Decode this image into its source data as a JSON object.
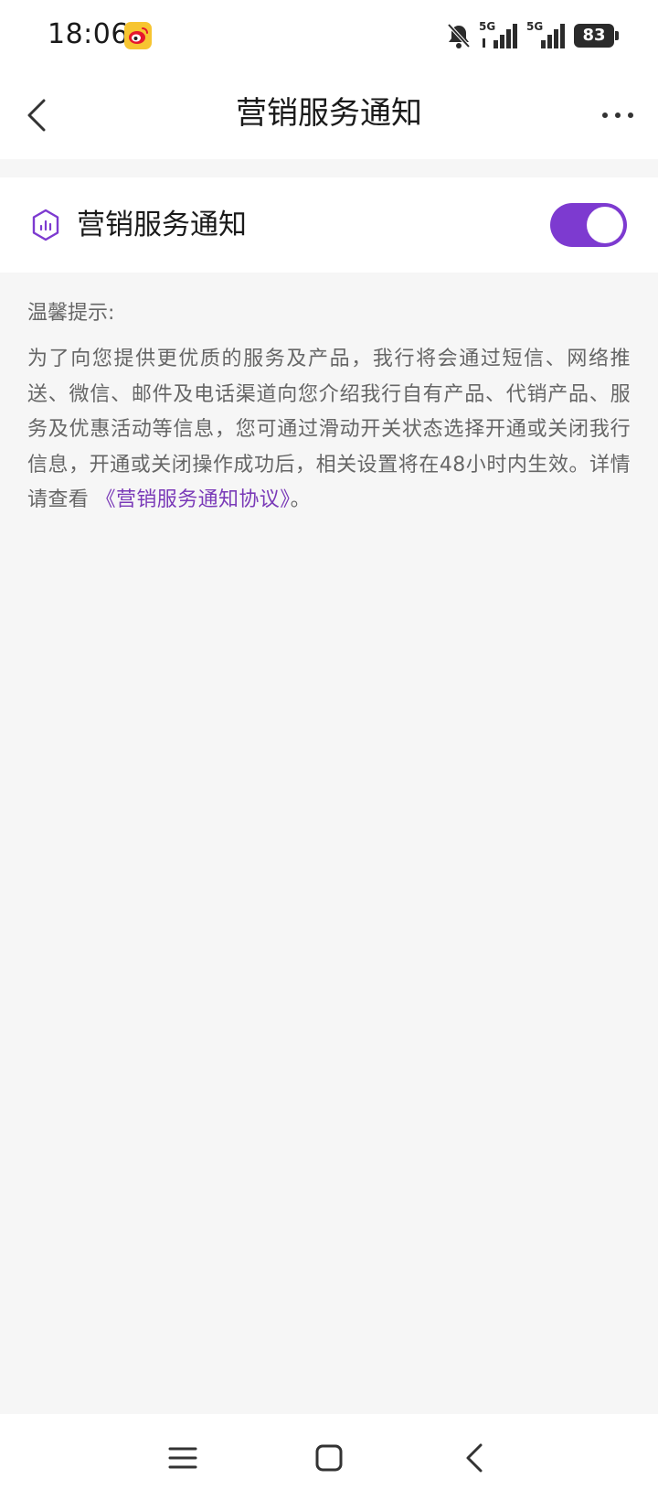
{
  "status_bar": {
    "time": "18:06",
    "signal_label_1": "5G",
    "signal_label_2": "5G",
    "battery": "83",
    "icons": [
      "weibo-icon",
      "bell-muted-icon",
      "signal-icon",
      "battery-icon"
    ]
  },
  "header": {
    "title": "营销服务通知",
    "back_icon": "chevron-left-icon",
    "more_icon": "more-dots-icon"
  },
  "setting": {
    "label": "营销服务通知",
    "icon": "hexagon-chart-icon",
    "enabled": true
  },
  "tips": {
    "title": "温馨提示:",
    "body": "为了向您提供更优质的服务及产品，我行将会通过短信、网络推送、微信、邮件及电话渠道向您介绍我行自有产品、代销产品、服务及优惠活动等信息，您可通过滑动开关状态选择开通或关闭我行信息，开通或关闭操作成功后，相关设置将在48小时内生效。详情请查看",
    "link": "《营销服务通知协议》",
    "end": "。"
  },
  "system_nav": {
    "icons": [
      "menu-icon",
      "home-icon",
      "back-icon"
    ]
  },
  "colors": {
    "accent": "#7d3ad0",
    "link": "#7a3ab8",
    "background": "#f6f6f6",
    "text_secondary": "#666666"
  }
}
